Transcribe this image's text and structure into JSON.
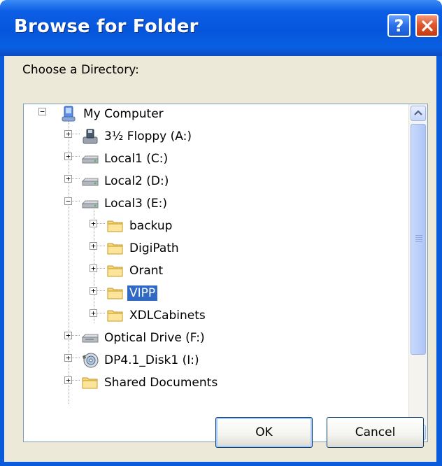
{
  "dialog": {
    "title": "Browse for Folder",
    "help_label": "?",
    "prompt": "Choose a Directory:",
    "ok_label": "OK",
    "cancel_label": "Cancel"
  },
  "tree": {
    "items": [
      {
        "label": "My Computer",
        "icon": "computer-icon",
        "expander": "−"
      },
      {
        "label": "3½ Floppy (A:)",
        "icon": "floppy-drive-icon",
        "expander": "+"
      },
      {
        "label": "Local1 (C:)",
        "icon": "hard-drive-icon",
        "expander": "+"
      },
      {
        "label": "Local2 (D:)",
        "icon": "hard-drive-icon",
        "expander": "+"
      },
      {
        "label": "Local3 (E:)",
        "icon": "hard-drive-icon",
        "expander": "−"
      },
      {
        "label": "backup",
        "icon": "folder-icon",
        "expander": "+"
      },
      {
        "label": "DigiPath",
        "icon": "folder-icon",
        "expander": "+"
      },
      {
        "label": "Orant",
        "icon": "folder-icon",
        "expander": "+"
      },
      {
        "label": "VIPP",
        "icon": "folder-icon",
        "expander": "+",
        "selected": true
      },
      {
        "label": "XDLCabinets",
        "icon": "folder-icon",
        "expander": "+"
      },
      {
        "label": "Optical Drive (F:)",
        "icon": "optical-drive-icon",
        "expander": "+"
      },
      {
        "label": "DP4.1_Disk1 (I:)",
        "icon": "cd-disc-icon",
        "expander": "+"
      },
      {
        "label": "Shared Documents",
        "icon": "folder-icon",
        "expander": "+"
      }
    ]
  },
  "colors": {
    "title_bar": "#0a5adc",
    "dialog_face": "#ece9d8",
    "selection": "#316ac5"
  }
}
